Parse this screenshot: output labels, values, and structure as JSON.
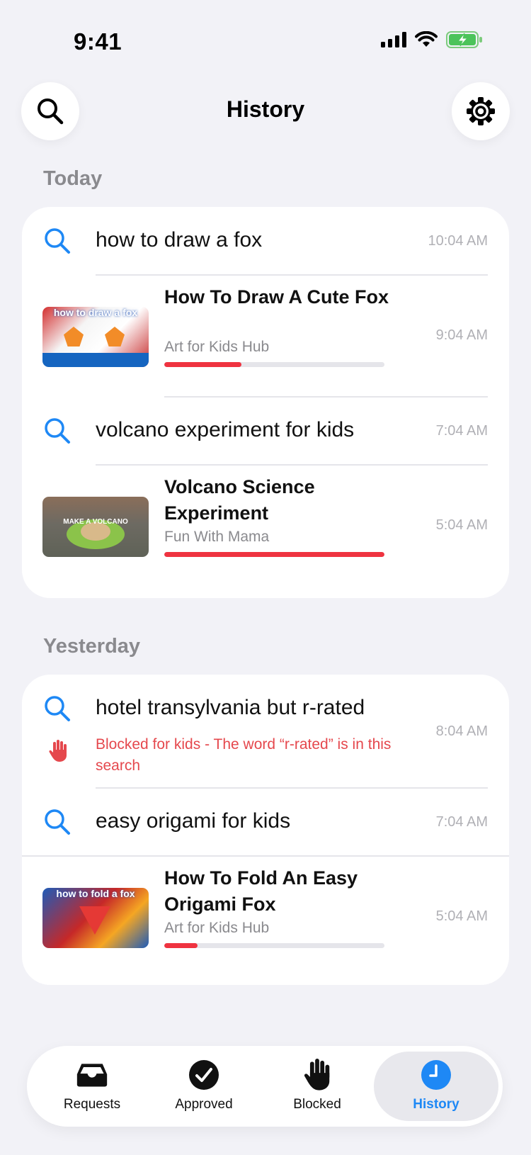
{
  "status_bar": {
    "time": "9:41"
  },
  "header": {
    "title": "History"
  },
  "sections": [
    {
      "label": "Today",
      "items": [
        {
          "type": "search",
          "query": "how to draw a fox",
          "time": "10:04 AM"
        },
        {
          "type": "video",
          "title": "How To Draw A Cute Fox",
          "channel": "Art for Kids Hub",
          "time": "9:04 AM",
          "progress": 0.35
        },
        {
          "type": "search",
          "query": "volcano experiment for kids",
          "time": "7:04 AM"
        },
        {
          "type": "video",
          "title": "Volcano Science Experiment",
          "channel": "Fun With Mama",
          "time": "5:04 AM",
          "progress": 1.0
        }
      ]
    },
    {
      "label": "Yesterday",
      "items": [
        {
          "type": "search",
          "query": "hotel transylvania but r-rated",
          "time": "8:04 AM",
          "blocked_message": "Blocked for kids - The word “r-rated” is in this search"
        },
        {
          "type": "search",
          "query": "easy origami for kids",
          "time": "7:04 AM"
        },
        {
          "type": "video",
          "title": "How To Fold An Easy Origami Fox",
          "channel": "Art for Kids Hub",
          "time": "5:04 AM",
          "progress": 0.15
        }
      ]
    }
  ],
  "thumbnails": {
    "fox_draw": "how to draw a fox",
    "volcano": "MAKE A VOLCANO",
    "origami": "how to fold a fox"
  },
  "tabs": [
    {
      "label": "Requests",
      "icon": "inbox-icon",
      "active": false
    },
    {
      "label": "Approved",
      "icon": "checkmark-circle-icon",
      "active": false
    },
    {
      "label": "Blocked",
      "icon": "hand-icon",
      "active": false
    },
    {
      "label": "History",
      "icon": "clock-icon",
      "active": true
    }
  ],
  "colors": {
    "accent": "#1E88F5",
    "progress": "#EF3340",
    "blocked": "#E5484D",
    "background": "#F2F2F7"
  }
}
